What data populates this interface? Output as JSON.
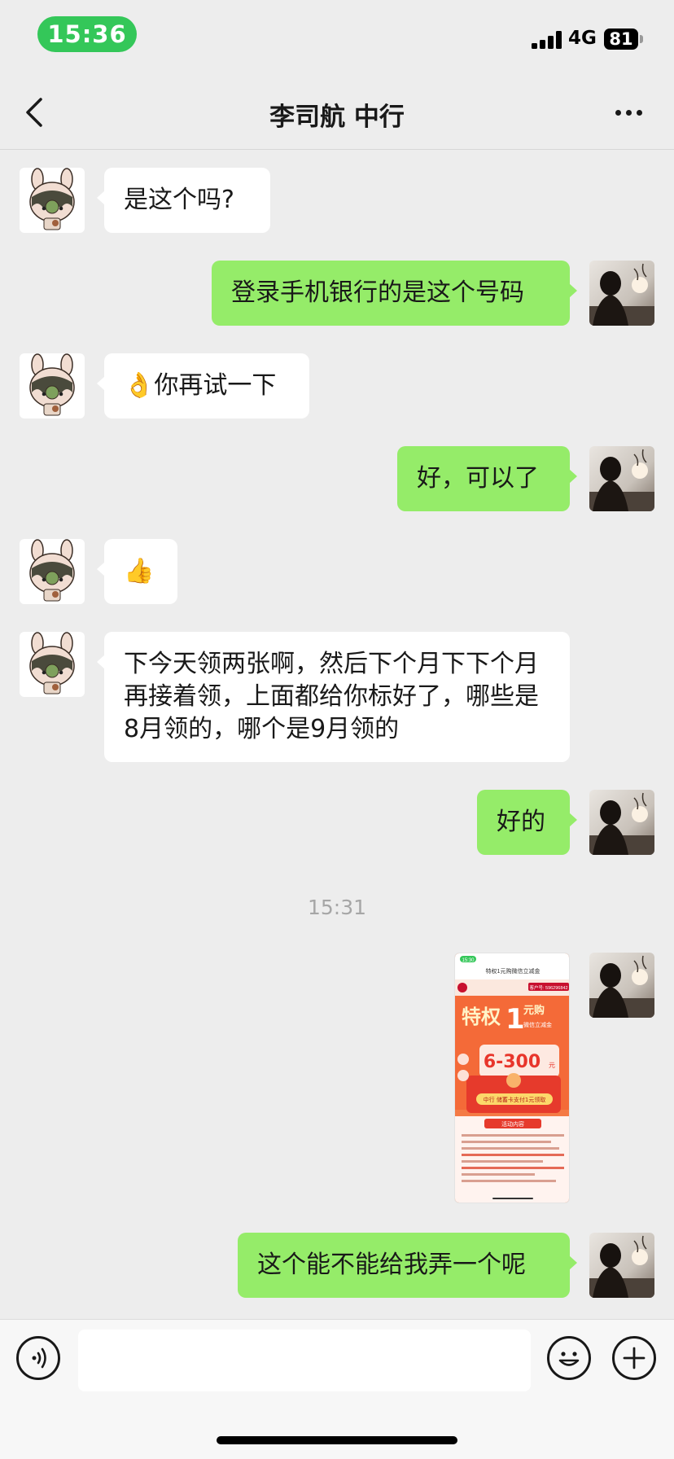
{
  "status_bar": {
    "time": "15:36",
    "network": "4G",
    "battery": "81"
  },
  "header": {
    "title": "李司航  中行"
  },
  "messages": [
    {
      "sender": "contact",
      "text": "是这个吗?"
    },
    {
      "sender": "me",
      "text": "登录手机银行的是这个号码"
    },
    {
      "sender": "contact",
      "emoji": "👌",
      "text": "你再试一下"
    },
    {
      "sender": "me",
      "text": "好，可以了"
    },
    {
      "sender": "contact",
      "emoji": "👍"
    },
    {
      "sender": "contact",
      "text": "下今天领两张啊，然后下个月下下个月再接着领，上面都给你标好了，哪些是8月领的，哪个是9月领的"
    },
    {
      "sender": "me",
      "text": "好的"
    },
    {
      "sender": "me",
      "type": "image",
      "image": {
        "status_time": "15:30",
        "page_title": "特权1元购微信立减金",
        "account": "客户号: 596296842",
        "banner_text": "特权",
        "banner_number": "1",
        "banner_suffix": "元购",
        "banner_sub": "微信立减金",
        "amount": "6-300",
        "amount_unit": "元",
        "cta": "中行 储蓄卡支付1元领取",
        "rules_title": "活动内容"
      }
    },
    {
      "sender": "me",
      "text": "这个能不能给我弄一个呢"
    }
  ],
  "time_divider": "15:31",
  "input": {
    "placeholder": ""
  },
  "colors": {
    "outgoing_bubble": "#95ec69",
    "incoming_bubble": "#ffffff",
    "background": "#ededed",
    "status_pill": "#34c759"
  }
}
